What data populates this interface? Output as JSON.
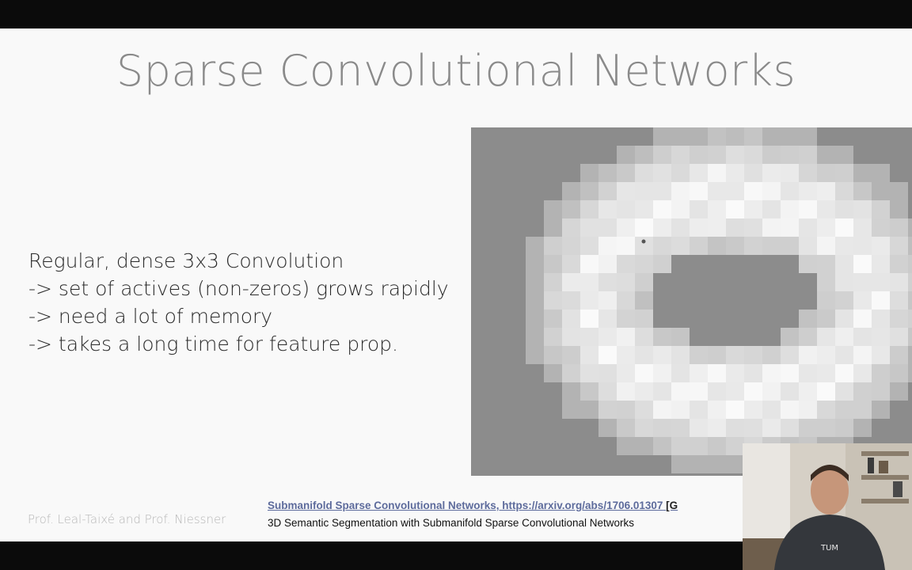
{
  "slide": {
    "title": "Sparse Convolutional Networks",
    "bullets": [
      "Regular, dense 3x3 Convolution",
      "-> set of actives (non-zeros) grows rapidly",
      "-> need a lot of memory",
      "-> takes a long time for feature prop."
    ],
    "footer": "Prof. Leal-Taixé and Prof. Niessner",
    "reference_link": "Submanifold Sparse Convolutional Networks, https://arxiv.org/abs/1706.01307",
    "reference_tag": "[G",
    "reference_caption": "3D Semantic Segmentation with Submanifold Sparse Convolutional Networks"
  },
  "figure": {
    "icon": "pixelated-ring-activation-map",
    "background_color": "#8c8c8c",
    "active_color": "#fafafa"
  },
  "webcam": {
    "icon": "presenter-webcam",
    "shirt_text": "TUM"
  }
}
